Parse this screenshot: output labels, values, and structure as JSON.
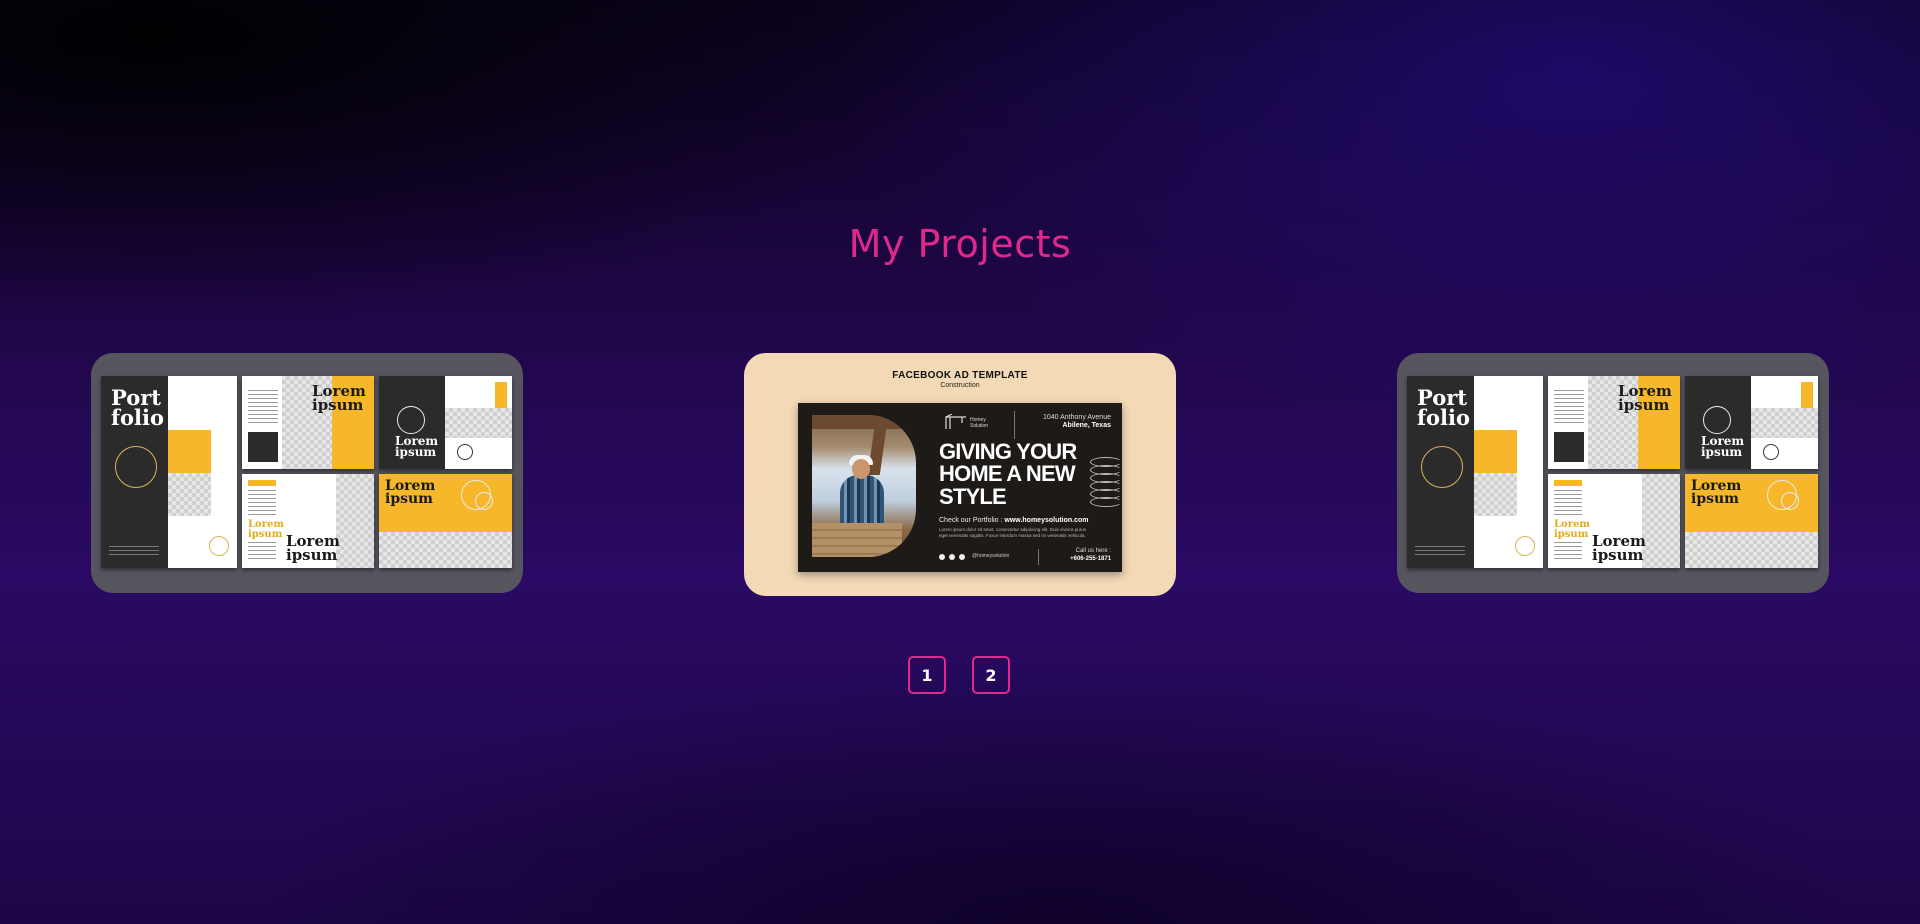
{
  "section": {
    "title": "My Projects"
  },
  "portfolio": {
    "cover_title": "Port\nfolio",
    "headline": "Lorem\nipsum"
  },
  "facebook_ad": {
    "template_title": "FACEBOOK AD TEMPLATE",
    "template_subtitle": "Construction",
    "logo_text": "Homey\nSolution",
    "address_line1": "1040 Anthony Avenue",
    "address_line2": "Abilene, Texas",
    "headline": "GIVING YOUR HOME A NEW STYLE",
    "portfolio_label": "Check our Portfolio :",
    "portfolio_url": "www.homeysolution.com",
    "body_text": "Lorem ipsum dolor sit amet, consectetur adipiscing elit. Duis viverra purus eget venenatis sagittis. Fusce interdum massa sed mi venenatis vehicula.",
    "social_handle": "@homeysolution",
    "call_label": "Call us here :",
    "phone": "+606-255-1871"
  },
  "pagination": {
    "pages": [
      "1",
      "2"
    ]
  },
  "colors": {
    "accent": "#e0288c",
    "portfolio_yellow": "#f6b72a",
    "ad_background": "#f3d9b6"
  }
}
